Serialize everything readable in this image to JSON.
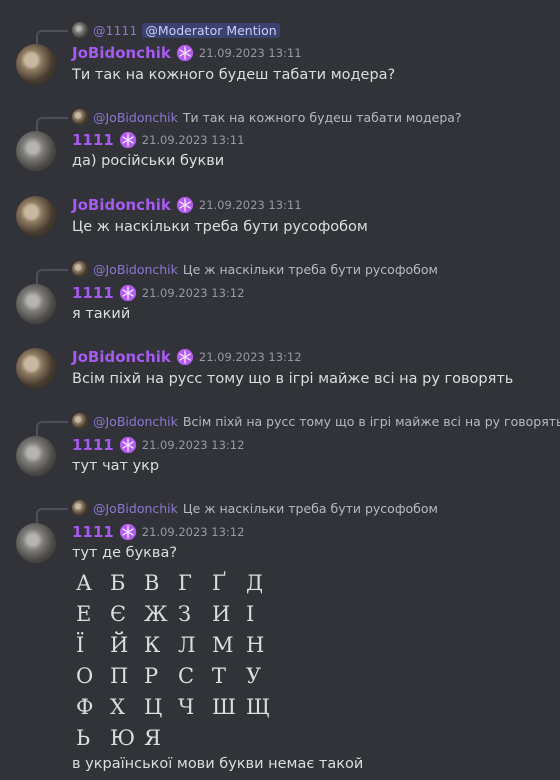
{
  "messages": [
    {
      "reply": {
        "name": "@1111",
        "mention": "@Moderator Mention"
      },
      "author": "JoBidonchik",
      "timestamp": "21.09.2023 13:11",
      "text": "Ти так на кожного будеш табати модера?"
    },
    {
      "reply": {
        "name": "@JoBidonchik",
        "text": "Ти так на кожного будеш табати модера?"
      },
      "author": "1111",
      "timestamp": "21.09.2023 13:11",
      "text": "да) російськи букви"
    },
    {
      "author": "JoBidonchik",
      "timestamp": "21.09.2023 13:11",
      "text": "Це ж наскільки треба бути русофобом"
    },
    {
      "reply": {
        "name": "@JoBidonchik",
        "text": "Це ж наскільки треба бути русофобом"
      },
      "author": "1111",
      "timestamp": "21.09.2023 13:12",
      "text": "я такий"
    },
    {
      "author": "JoBidonchik",
      "timestamp": "21.09.2023 13:12",
      "text": "Всім піхй на русс тому що в ігрі майже всі на ру говорять"
    },
    {
      "reply": {
        "name": "@JoBidonchik",
        "text": "Всім піхй на русс тому що в ігрі майже всі на ру говорять"
      },
      "author": "1111",
      "timestamp": "21.09.2023 13:12",
      "text": "тут чат укр"
    },
    {
      "reply": {
        "name": "@JoBidonchik",
        "text": "Це ж наскільки треба бути русофобом"
      },
      "author": "1111",
      "timestamp": "21.09.2023 13:12",
      "text": "тут де буква?",
      "alphabet": [
        "А",
        "Б",
        "В",
        "Г",
        "Ґ",
        "Д",
        "Е",
        "Є",
        "Ж",
        "З",
        "И",
        "І",
        "Ї",
        "Й",
        "К",
        "Л",
        "М",
        "Н",
        "О",
        "П",
        "Р",
        "С",
        "Т",
        "У",
        "Ф",
        "Х",
        "Ц",
        "Ч",
        "Ш",
        "Щ",
        "Ь",
        "Ю",
        "Я"
      ],
      "text2": "в української мови букви немає такой"
    }
  ],
  "colors": {
    "background": "#313338",
    "username": "#a65bf0",
    "timestamp": "#949ba4",
    "mention_bg": "#3c4270"
  },
  "icons": {
    "badge": "snowflake-badge-icon",
    "avatar_jobidonchik": "brown-cat-avatar",
    "avatar_1111": "grey-cat-avatar"
  }
}
